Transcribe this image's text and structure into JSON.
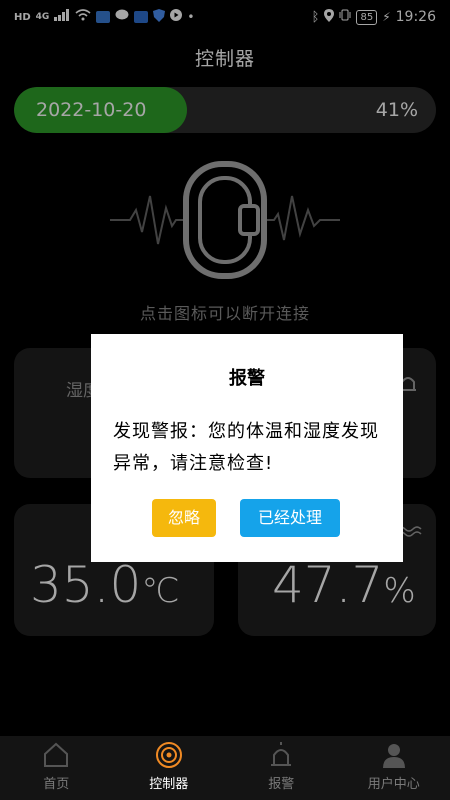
{
  "status_bar": {
    "left_text": "HD",
    "network": "4G",
    "battery": "85",
    "time": "19:26"
  },
  "header": {
    "title": "控制器"
  },
  "progress": {
    "date": "2022-10-20",
    "percent_label": "41%",
    "value": 0.41
  },
  "device": {
    "hint": "点击图标可以断开连接"
  },
  "cards": {
    "humidity_top": {
      "label": "湿度"
    },
    "temperature": {
      "value": "35.0",
      "unit": "℃"
    },
    "humidity": {
      "value": "47.7",
      "unit": "%"
    }
  },
  "dialog": {
    "title": "报警",
    "message": "发现警报：您的体温和湿度发现异常，请注意检查!",
    "ignore_label": "忽略",
    "handled_label": "已经处理"
  },
  "nav": {
    "items": [
      {
        "label": "首页",
        "icon": "home-icon",
        "active": false
      },
      {
        "label": "控制器",
        "icon": "signal-icon",
        "active": true
      },
      {
        "label": "报警",
        "icon": "alarm-icon",
        "active": false
      },
      {
        "label": "用户中心",
        "icon": "user-icon",
        "active": false
      }
    ]
  },
  "colors": {
    "progress_fill": "#2e9e2a",
    "ignore_button": "#f5b80d",
    "handled_button": "#15a3ea",
    "nav_active_icon": "#f08a24"
  }
}
